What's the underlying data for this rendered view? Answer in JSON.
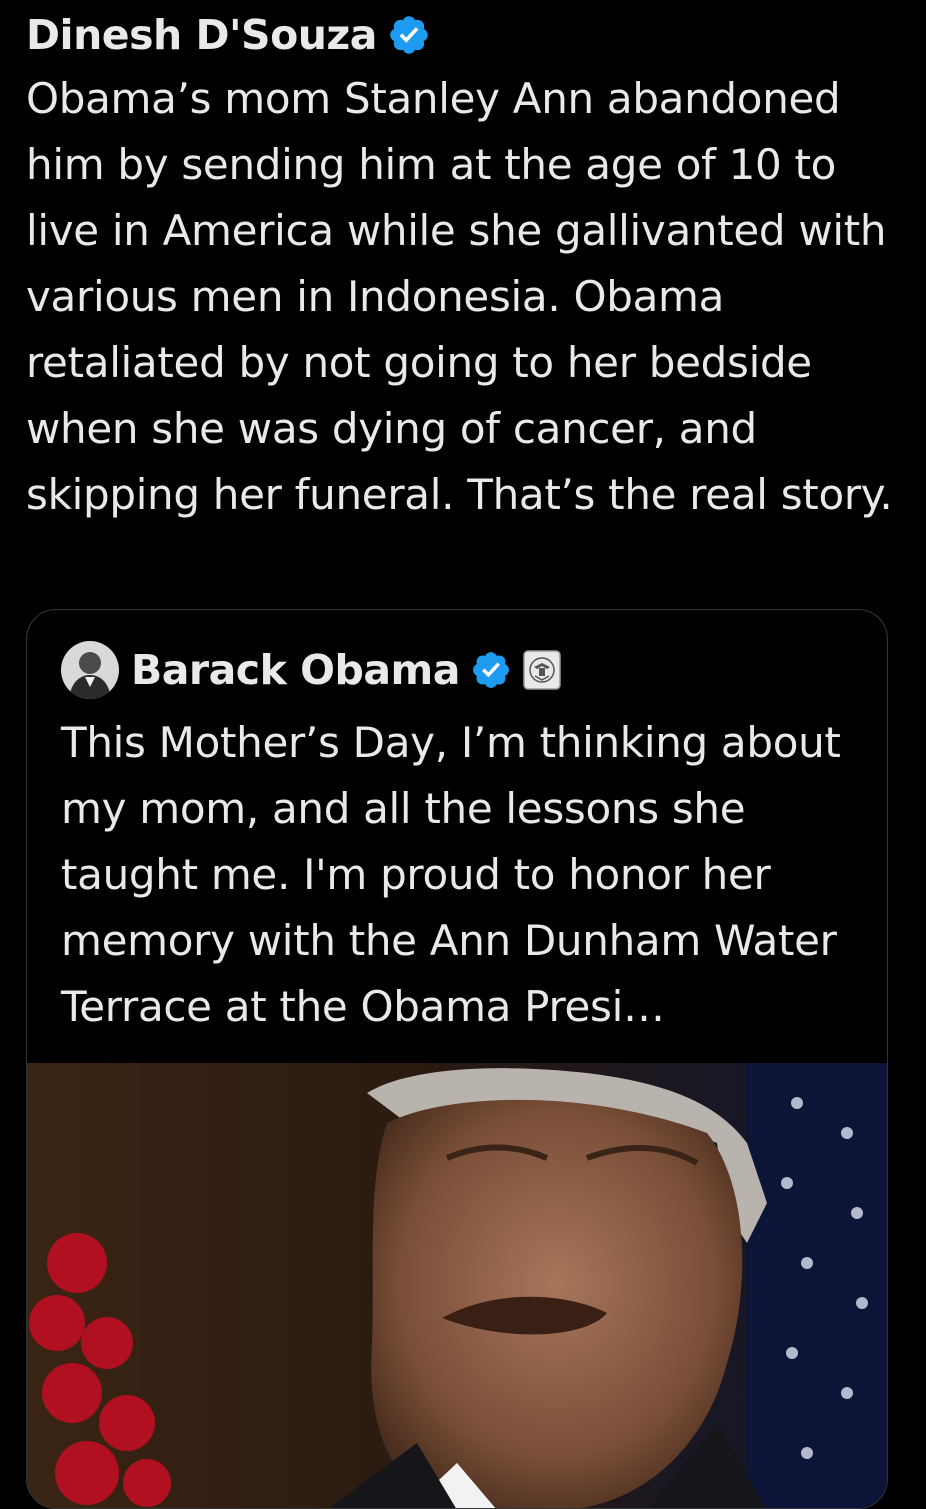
{
  "tweet": {
    "author_name": "Dinesh D'Souza",
    "verified_icon": "verified-badge-icon",
    "text": "Obama’s mom Stanley Ann abandoned him by sending him at the age of 10 to live in America while she gallivanted with various men in Indonesia. Obama retaliated by not going to her bedside when she was dying of cancer, and skipping her funeral. That’s the real story."
  },
  "quoted_tweet": {
    "author_name": "Barack Obama",
    "verified_icon": "verified-badge-icon",
    "affiliation_icon": "government-seal-icon",
    "text": "This Mother’s Day, I’m thinking about my mom, and all the lessons she taught me. I'm proud to honor her memory with the Ann Dunham Water Terrace at the Obama Presi…",
    "media_icon": "video-thumbnail"
  },
  "colors": {
    "background": "#000000",
    "text": "#e7e9ea",
    "verified": "#1d9bf0",
    "border": "#333639"
  }
}
